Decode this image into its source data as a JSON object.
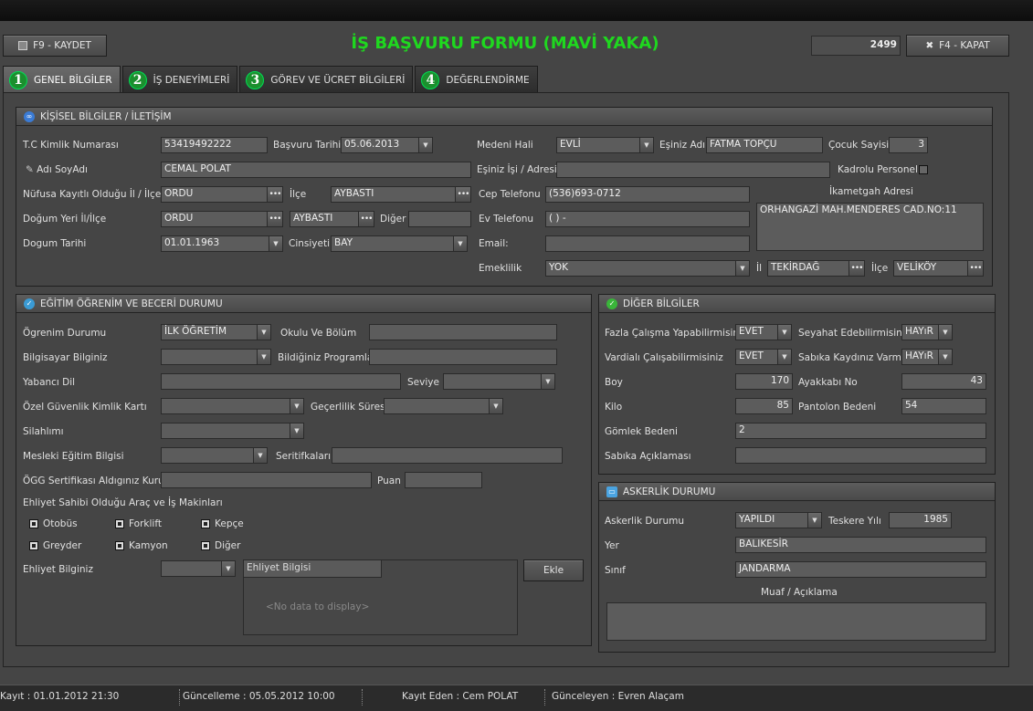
{
  "toolbar": {
    "save_label": "F9 - KAYDET",
    "close_label": "F4 - KAPAT",
    "record_no": "2499"
  },
  "form_title": "İŞ BAŞVURU FORMU (MAVİ YAKA)",
  "tabs": [
    {
      "num": "1",
      "label": "GENEL BİLGİLER"
    },
    {
      "num": "2",
      "label": "İŞ DENEYİMLERİ"
    },
    {
      "num": "3",
      "label": "GÖREV VE ÜCRET BİLGİLERİ"
    },
    {
      "num": "4",
      "label": "DEĞERLENDİRME"
    }
  ],
  "personal": {
    "header": "KİŞİSEL BİLGİLER / İLETİŞİM",
    "tc_label": "T.C Kimlik Numarası",
    "tc": "53419492222",
    "apply_date_label": "Başvuru Tarihi",
    "apply_date": "05.06.2013",
    "marital_label": "Medeni Hali",
    "marital": "EVLİ",
    "spouse_label": "Eşiniz Adı",
    "spouse": "FATMA TOPÇU",
    "children_label": "Çocuk Sayisi",
    "children": "3",
    "name_label": "Adı SoyAdı",
    "name": "CEMAL POLAT",
    "spouse_job_label": "Eşiniz İşi / Adresi",
    "spouse_job": "",
    "staff_label": "Kadrolu Personel",
    "registry_label": "Nüfusa Kayıtlı Olduğu İl / İlçe",
    "registry_city": "ORDU",
    "district_label": "İlçe",
    "registry_district": "AYBASTI",
    "mobile_label": "Cep  Telefonu",
    "mobile": "(536)693-0712",
    "residence_label": "İkametgah Adresi",
    "residence": "ORHANGAZİ MAH.MENDERES CAD.NO:11",
    "birthplace_label": "Doğum Yeri İl/İlçe",
    "birth_city": "ORDU",
    "birth_district": "AYBASTI",
    "other_label": "Diğer",
    "other": "",
    "home_phone_label": "Ev Telefonu",
    "home_phone": "(   )   -",
    "birthdate_label": "Dogum Tarihi",
    "birthdate": "01.01.1963",
    "gender_label": "Cinsiyeti",
    "gender": "BAY",
    "email_label": "Email:",
    "email": "",
    "retired_label": "Emeklilik",
    "retired": "YOK",
    "il_label": "İl",
    "il": "TEKİRDAĞ",
    "ilce_label": "İlçe",
    "ilce": "VELİKÖY"
  },
  "education": {
    "header": "EĞİTİM ÖĞRENİM VE BECERİ DURUMU",
    "status_label": "Ögrenim Durumu",
    "status": "İLK ÖĞRETİM",
    "school_label": "Okulu Ve Bölüm",
    "school": "",
    "computer_label": "Bilgisayar Bilginiz",
    "computer": "",
    "programs_label": "Bildiğiniz Programlar",
    "programs": "",
    "lang_label": "Yabancı Dil",
    "lang": "",
    "level_label": "Seviye",
    "level": "",
    "security_label": "Özel Güvenlik Kimlik Kartı",
    "security": "",
    "validity_label": "Geçerlilik Süresi",
    "validity": "",
    "weapon_label": "Silahlımı",
    "weapon": "",
    "voc_label": "Mesleki Eğitim Bilgisi",
    "voc": "",
    "cert_label": "Seritifkaları",
    "cert": "",
    "ogg_label": "ÖGG Sertifikası Aldıgınız Kurum",
    "ogg": "",
    "score_label": "Puan",
    "score": "",
    "vehicles_label": "Ehliyet Sahibi Olduğu Araç ve İş Makinları",
    "vehicles": [
      "Otobüs",
      "Forklift",
      "Kepçe",
      "Greyder",
      "Kamyon",
      "Diğer"
    ],
    "license_label": "Ehliyet Bilginiz",
    "license": "",
    "grid_header": "Ehliyet Bilgisi",
    "grid_empty": "<No data to display>",
    "add_label": "Ekle"
  },
  "other": {
    "header": "DİĞER BİLGİLER",
    "overtime_label": "Fazla Çalışma Yapabilirmisiniz",
    "overtime": "EVET",
    "travel_label": "Seyahat Edebilirmisiniz",
    "travel": "HAYıR",
    "shift_label": "Vardialı Çalışabilirmisiniz",
    "shift": "EVET",
    "record_label": "Sabıka Kaydınız Varmı",
    "record": "HAYıR",
    "height_label": "Boy",
    "height": "170",
    "shoe_label": "Ayakkabı No",
    "shoe": "43",
    "weight_label": "Kilo",
    "weight": "85",
    "pants_label": "Pantolon Bedeni",
    "pants": "54",
    "shirt_label": "Gömlek Bedeni",
    "shirt": "2",
    "record_desc_label": "Sabıka Açıklaması",
    "record_desc": ""
  },
  "military": {
    "header": "ASKERLİK DURUMU",
    "status_label": "Askerlik Durumu",
    "status": "YAPILDI",
    "discharge_label": "Teskere Yılı",
    "discharge": "1985",
    "place_label": "Yer",
    "place": "BALIKESİR",
    "class_label": "Sınıf",
    "class": "JANDARMA",
    "exempt_label": "Muaf / Açıklama",
    "exempt": ""
  },
  "status": {
    "created": "Kayıt : 01.01.2012 21:30",
    "updated": "Güncelleme : 05.05.2012 10:00",
    "created_by": "Kayıt Eden : Cem POLAT",
    "updated_by": "Günceleyen : Evren Alaçam"
  }
}
